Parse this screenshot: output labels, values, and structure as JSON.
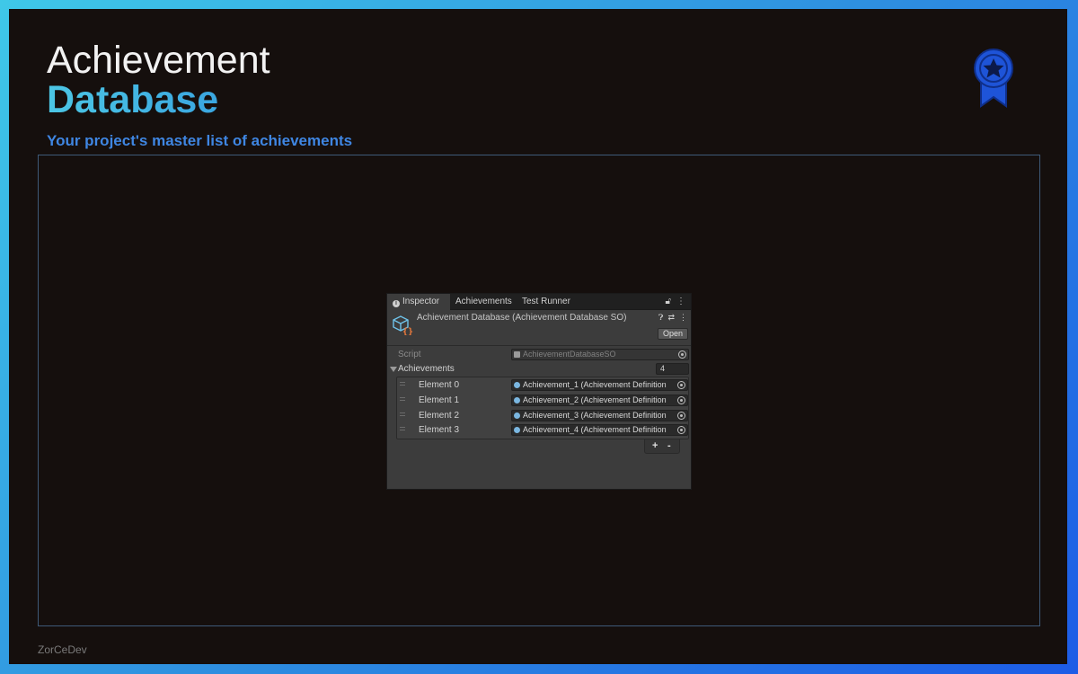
{
  "slide": {
    "title_line1": "Achievement",
    "title_line2": "Database",
    "subtitle": "Your project's master list of achievements",
    "badge_icon": "award-ribbon-star-icon",
    "footer": "ZorCeDev",
    "colors": {
      "frame_bg": "#150f0d",
      "title_accent": "#4cc6e4",
      "subtitle": "#3f86e2",
      "badge": "#1e54d8"
    }
  },
  "inspector": {
    "tabs": [
      {
        "label": "Inspector",
        "icon": "info-icon",
        "active": true
      },
      {
        "label": "Achievements",
        "active": false
      },
      {
        "label": "Test Runner",
        "active": false
      }
    ],
    "asset_title": "Achievement Database (Achievement Database SO)",
    "open_label": "Open",
    "script_label": "Script",
    "script_value": "AchievementDatabaseSO",
    "array_label": "Achievements",
    "array_count": "4",
    "elements": [
      {
        "label": "Element 0",
        "value": "Achievement_1 (Achievement Definition"
      },
      {
        "label": "Element 1",
        "value": "Achievement_2 (Achievement Definition"
      },
      {
        "label": "Element 2",
        "value": "Achievement_3 (Achievement Definition"
      },
      {
        "label": "Element 3",
        "value": "Achievement_4 (Achievement Definition"
      }
    ],
    "add_label": "+",
    "remove_label": "-"
  }
}
